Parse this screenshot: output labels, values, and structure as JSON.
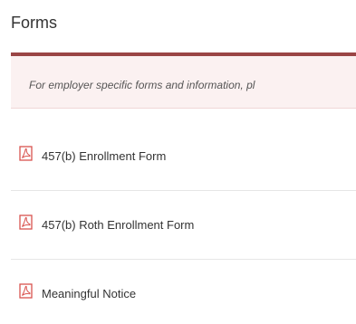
{
  "page": {
    "title": "Forms"
  },
  "notice": {
    "text": "For employer specific forms and information, pl"
  },
  "forms": [
    {
      "label": "457(b) Enrollment Form",
      "icon": "pdf-icon"
    },
    {
      "label": "457(b) Roth Enrollment Form",
      "icon": "pdf-icon"
    },
    {
      "label": "Meaningful Notice",
      "icon": "pdf-icon"
    }
  ],
  "colors": {
    "accent": "#9a4545",
    "notice_bg": "#fbf1f1",
    "pdf_icon": "#d9534f"
  }
}
